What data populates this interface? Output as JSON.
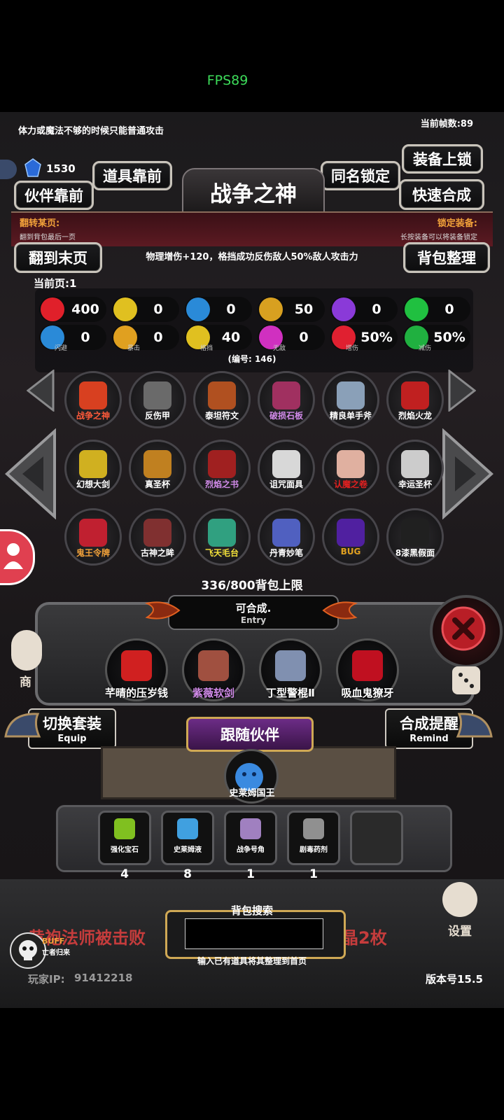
{
  "status": {
    "fps": "FPS89"
  },
  "header": {
    "tip": "体力或魔法不够的时候只能普通攻击",
    "current_fps": "当前帧数:89",
    "gem_count": "1530",
    "title": "战争之神"
  },
  "buttons": {
    "items_front": "道具靠前",
    "partner_front": "伙伴靠前",
    "same_name_lock": "同名锁定",
    "equip_lock": "装备上锁",
    "quick_merge": "快速合成",
    "last_page": "翻到末页",
    "sort_bag": "背包整理",
    "switch_set": "切换套装",
    "switch_set_en": "Equip",
    "merge_remind": "合成提醒",
    "merge_remind_en": "Remind",
    "settings": "设置"
  },
  "info": {
    "flip_title": "翻转某页:",
    "flip_sub": "翻到背包最后一页",
    "lock_title": "锁定装备:",
    "lock_sub": "长按装备可以将装备锁定",
    "description": "物理增伤+120，格挡成功反伤敌人50%敌人攻击力",
    "current_page": "当前页:1",
    "serial": "(编号: 146)"
  },
  "stats": [
    {
      "icon": "heart-icon",
      "value": "400",
      "label": "",
      "color": "#e0202a"
    },
    {
      "icon": "muscle-icon",
      "value": "0",
      "label": "",
      "color": "#e0c020"
    },
    {
      "icon": "helmet-icon",
      "value": "0",
      "label": "",
      "color": "#2a8ad8"
    },
    {
      "icon": "sword-icon",
      "value": "50",
      "label": "",
      "color": "#d8a020"
    },
    {
      "icon": "lightning-icon",
      "value": "0",
      "label": "",
      "color": "#8a3ad8"
    },
    {
      "icon": "clover-icon",
      "value": "0",
      "label": "",
      "color": "#20c040"
    },
    {
      "icon": "wing-icon",
      "value": "0",
      "label": "闪避",
      "color": "#2a8ad8"
    },
    {
      "icon": "crit-icon",
      "value": "0",
      "label": "暴击",
      "color": "#e0a020"
    },
    {
      "icon": "shield-icon",
      "value": "40",
      "label": "格挡",
      "color": "#e0c020"
    },
    {
      "icon": "angel-icon",
      "value": "0",
      "label": "无敌",
      "color": "#d030c0"
    },
    {
      "icon": "crossed-swords-icon",
      "value": "50%",
      "label": "增伤",
      "color": "#e02030"
    },
    {
      "icon": "guard-icon",
      "value": "50%",
      "label": "减伤",
      "color": "#20b040"
    }
  ],
  "grid": [
    {
      "name": "战争之神",
      "color": "#d84020",
      "text_color": "#ff5a3a"
    },
    {
      "name": "反伤甲",
      "color": "#6a6a6a",
      "text_color": "#ffffff"
    },
    {
      "name": "泰坦符文",
      "color": "#b05020",
      "text_color": "#ffffff"
    },
    {
      "name": "破损石板",
      "color": "#a03060",
      "text_color": "#d08ae8"
    },
    {
      "name": "精良单手斧",
      "color": "#8aa0b8",
      "text_color": "#ffffff"
    },
    {
      "name": "烈焰火龙",
      "color": "#c02020",
      "text_color": "#ffffff"
    },
    {
      "name": "幻想大剑",
      "color": "#d0b020",
      "text_color": "#ffffff"
    },
    {
      "name": "真圣杯",
      "color": "#c08020",
      "text_color": "#ffffff"
    },
    {
      "name": "烈焰之书",
      "color": "#a02020",
      "text_color": "#d08ae8"
    },
    {
      "name": "诅咒面具",
      "color": "#d8d8d8",
      "text_color": "#ffffff"
    },
    {
      "name": "认魔之卷",
      "color": "#e0b0a0",
      "text_color": "#e02020"
    },
    {
      "name": "幸运圣杯",
      "color": "#cccccc",
      "text_color": "#ffffff"
    },
    {
      "name": "鬼王令牌",
      "color": "#c02030",
      "text_color": "#f2a23a"
    },
    {
      "name": "古神之眸",
      "color": "#803030",
      "text_color": "#ffffff"
    },
    {
      "name": "飞天毛台",
      "color": "#30a080",
      "text_color": "#f2e03a"
    },
    {
      "name": "丹青妙笔",
      "color": "#5060c0",
      "text_color": "#ffffff"
    },
    {
      "name": "BUG",
      "color": "#5020a0",
      "text_color": "#e0a020"
    },
    {
      "name": "8漆黑假面",
      "color": "#202020",
      "text_color": "#ffffff"
    }
  ],
  "capacity": "336/800背包上限",
  "entry": {
    "title": "可合成.",
    "subtitle": "Entry",
    "items": [
      {
        "name": "芊晴的压岁钱",
        "color": "#d02020",
        "text_color": "#ffffff"
      },
      {
        "name": "紫薇软剑",
        "color": "#a05040",
        "text_color": "#d08ae8"
      },
      {
        "name": "丁型警棍Ⅱ",
        "color": "#8090b0",
        "text_color": "#ffffff"
      },
      {
        "name": "吸血鬼獠牙",
        "color": "#c01020",
        "text_color": "#ffffff"
      }
    ]
  },
  "follow": {
    "title": "跟随伙伴",
    "partner_name": "史莱姆国王"
  },
  "inventory": [
    {
      "name": "强化宝石",
      "count": "4",
      "color": "#80c020"
    },
    {
      "name": "史莱姆液",
      "count": "8",
      "color": "#40a0e0"
    },
    {
      "name": "战争号角",
      "count": "1",
      "color": "#a080c0"
    },
    {
      "name": "剧毒药剂",
      "count": "1",
      "color": "#909090"
    },
    {
      "name": "",
      "count": "",
      "color": "#2a2a2a"
    }
  ],
  "footer": {
    "search_title": "背包搜索",
    "search_hint": "输入已有道具将其整理到首页",
    "news_left": "黄袍法师被击败",
    "news_right": "晶2枚",
    "buff": "BUFF",
    "buff_sub": "亡者归来",
    "player_ip_label": "玩家IP:",
    "player_ip": "91412218",
    "version": "版本号15.5",
    "shop": "商"
  }
}
